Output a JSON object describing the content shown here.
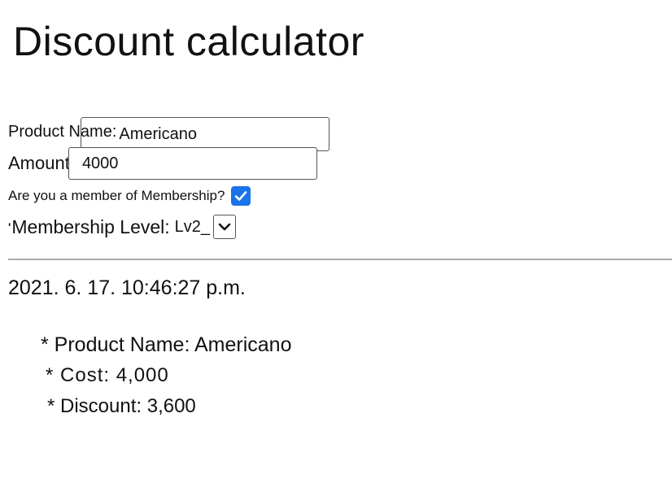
{
  "page": {
    "title": "Discount calculator"
  },
  "form": {
    "product_name_label": "Product Name:",
    "product_name_value": "Americano",
    "amount_label": "Amount:",
    "amount_value": "4000",
    "membership_question": "Are you a member of Membership?",
    "membership_checked": true,
    "membership_level_label": "Membership Level:",
    "membership_level_value": "Lv2_"
  },
  "result": {
    "datetime": "2021. 6. 17. 10:46:27 p.m.",
    "product_line": "* Product Name: Americano",
    "cost_line": "* Cost: 4,000",
    "discount_line": "* Discount: 3,600"
  },
  "colors": {
    "checkbox": "#1a73e8",
    "divider": "#aaaaaa"
  }
}
